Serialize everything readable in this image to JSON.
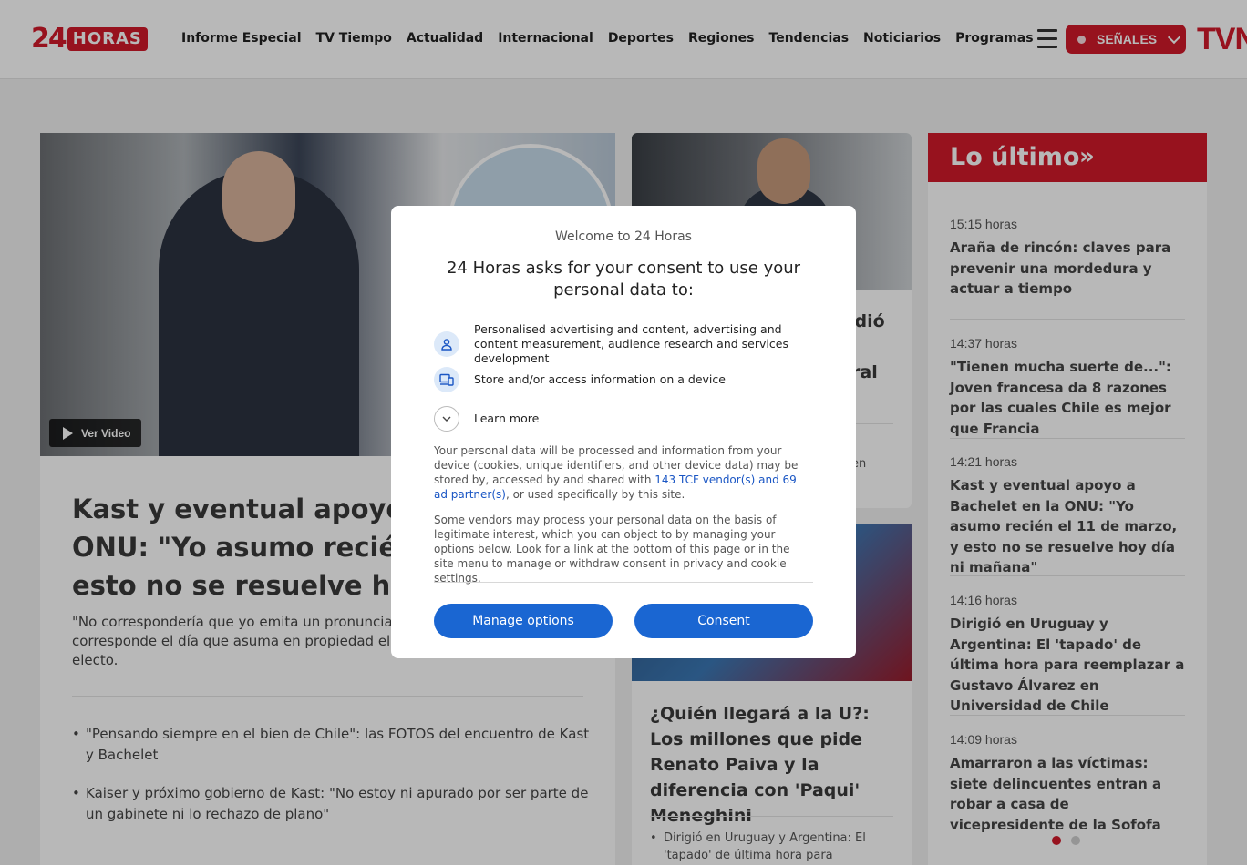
{
  "header": {
    "logo_number": "24",
    "logo_word": "HORAS",
    "nav": [
      "Informe Especial",
      "TV Tiempo",
      "Actualidad",
      "Internacional",
      "Deportes",
      "Regiones",
      "Tendencias",
      "Noticiarios",
      "Programas"
    ],
    "signals_label": "SEÑALES",
    "brand": "TVN",
    "colors": {
      "accent": "#d11a2a"
    }
  },
  "main_story": {
    "video_label": "Ver Video",
    "headline": "Kast y eventual apoyo a B… ONU: \"Yo asumo recién el … esto no se resuelve hoy dí…",
    "headline_lines": [
      "Kast y eventual apoyo a B",
      "ONU: \"Yo asumo recién el",
      "esto no se resuelve hoy dí"
    ],
    "lead_lines": [
      "\"No correspondería que yo emita un pronuncian",
      "corresponde el día que asuma en propiedad el c",
      "electo."
    ],
    "related": [
      "\"Pensando siempre en el bien de Chile\": las FOTOS del encuentro de Kast y Bachelet",
      "Kaiser y próximo gobierno de Kast: \"No estoy ni apurado por ser parte de un gabinete ni lo rechazo de plano\""
    ]
  },
  "middle": {
    "story1_fragments": [
      "idió",
      "ral",
      "en"
    ],
    "story2_headline": "¿Quién llegará a la U?: Los millones que pide Renato Paiva y la diferencia con 'Paqui' Meneghini",
    "story2_related": "Dirigió en Uruguay y Argentina: El 'tapado' de última hora para"
  },
  "latest": {
    "title": "Lo último",
    "arrows": "»",
    "items": [
      {
        "time": "15:15 horas",
        "title": "Araña de rincón: claves para prevenir una mordedura y actuar a tiempo"
      },
      {
        "time": "14:37 horas",
        "title": "\"Tienen mucha suerte de...\": Joven francesa da 8 razones por las cuales Chile es mejor que Francia"
      },
      {
        "time": "14:21 horas",
        "title": "Kast y eventual apoyo a Bachelet en la ONU: \"Yo asumo recién el 11 de marzo, y esto no se resuelve hoy día ni mañana\""
      },
      {
        "time": "14:16 horas",
        "title": "Dirigió en Uruguay y Argentina: El 'tapado' de última hora para reemplazar a Gustavo Álvarez en Universidad de Chile"
      },
      {
        "time": "14:09 horas",
        "title": "Amarraron a las víctimas: siete delincuentes entran a robar a casa de vicepresidente de la Sofofa"
      }
    ],
    "pagination_active": 1
  },
  "consent": {
    "welcome": "Welcome to 24 Horas",
    "heading": "24 Horas asks for your consent to use your personal data to:",
    "purposes": [
      {
        "icon": "person-icon",
        "label": "Personalised advertising and content, advertising and content measurement, audience research and services development"
      },
      {
        "icon": "device-icon",
        "label": "Store and/or access information on a device"
      }
    ],
    "learn_more": "Learn more",
    "para1_before": "Your personal data will be processed and information from your device (cookies, unique identifiers, and other device data) may be stored by, accessed by and shared with ",
    "para1_link": "143 TCF vendor(s) and 69 ad partner(s)",
    "para1_after": ", or used specifically by this site.",
    "para2": "Some vendors may process your personal data on the basis of legitimate interest, which you can object to by managing your options below. Look for a link at the bottom of this page or in the site menu to manage or withdraw consent in privacy and cookie settings.",
    "manage_label": "Manage options",
    "consent_label": "Consent",
    "colors": {
      "button": "#1a66d2",
      "link": "#1a56c4"
    }
  }
}
